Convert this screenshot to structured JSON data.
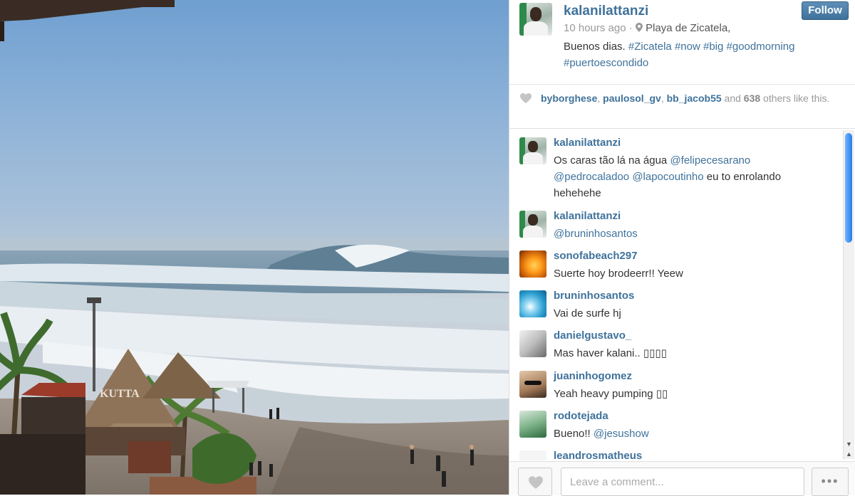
{
  "post": {
    "username": "kalanilattanzi",
    "time": "10 hours ago",
    "separator": "·",
    "location": "Playa de Zicatela,",
    "caption_text": "Buenos dias.",
    "hashtags": [
      "#Zicatela",
      "#now",
      "#big",
      "#goodmorning",
      "#puertoescondido"
    ],
    "follow_label": "Follow"
  },
  "photo": {
    "sign_text": "KUTTA"
  },
  "likes": {
    "users": [
      "byborghese",
      "paulosol_gv",
      "bb_jacob55"
    ],
    "and_text": "and",
    "count": "638",
    "suffix": "others like this."
  },
  "comments": [
    {
      "user": "kalanilattanzi",
      "avatar": "kalani-avatar",
      "text": "Os caras tão lá na água",
      "mentions": [
        "@felipecesarano",
        "@pedrocaladoo",
        "@lapocoutinho"
      ],
      "tail": "eu to enrolando hehehehe"
    },
    {
      "user": "kalanilattanzi",
      "avatar": "kalani-avatar",
      "text": "",
      "mentions": [
        "@bruninhosantos"
      ],
      "tail": ""
    },
    {
      "user": "sonofabeach297",
      "avatar": "sunset-avatar",
      "text": "Suerte hoy brodeerr!! Yeew",
      "mentions": [],
      "tail": ""
    },
    {
      "user": "bruninhosantos",
      "avatar": "wave-avatar",
      "text": "Vai de surfe hj",
      "mentions": [],
      "tail": ""
    },
    {
      "user": "danielgustavo_",
      "avatar": "gray-avatar",
      "text": "Mas haver kalani.. ▯▯▯▯",
      "mentions": [],
      "tail": ""
    },
    {
      "user": "juaninhogomez",
      "avatar": "glasses-avatar",
      "text": "Yeah heavy pumping ▯▯",
      "mentions": [],
      "tail": ""
    },
    {
      "user": "rodotejada",
      "avatar": "green-avatar",
      "text": "Bueno!!",
      "mentions": [
        "@jesushow"
      ],
      "tail": ""
    },
    {
      "user": "leandrosmatheus",
      "avatar": "blue-avatar",
      "text": "",
      "mentions": [],
      "tail": ""
    }
  ],
  "footer": {
    "comment_placeholder": "Leave a comment...",
    "more_label": "•••"
  },
  "colors": {
    "link": "#3f729b",
    "follow_button": "#3f729b",
    "scroll_thumb": "#2a7ee6"
  }
}
